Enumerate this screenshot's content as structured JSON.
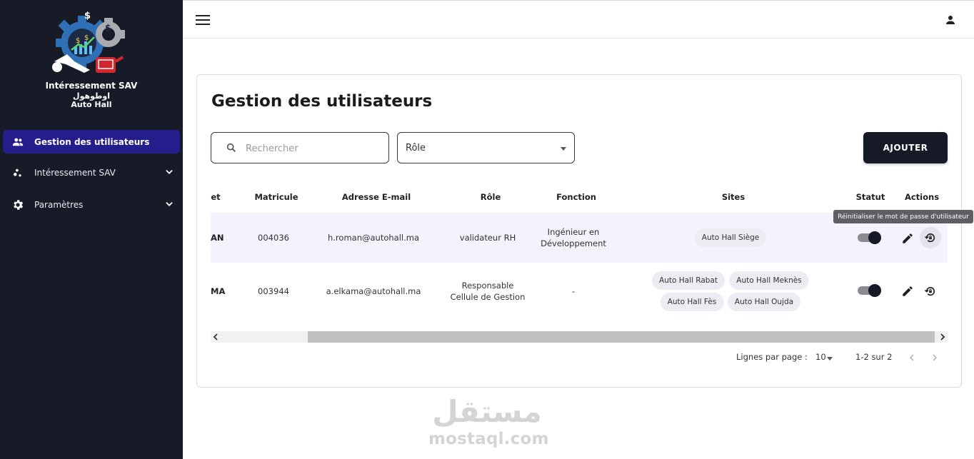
{
  "brand": {
    "line1": "Intéressement SAV",
    "line2": "اوطوهول",
    "line3": "Auto Hall"
  },
  "sidebar": {
    "items": [
      {
        "label": "Gestion des utilisateurs",
        "icon": "people-icon",
        "active": true
      },
      {
        "label": "Intéressement SAV",
        "icon": "bubble-chart-icon",
        "active": false
      },
      {
        "label": "Paramètres",
        "icon": "gear-icon",
        "active": false
      }
    ]
  },
  "main": {
    "title": "Gestion des utilisateurs",
    "search_placeholder": "Rechercher",
    "role_select": "Rôle",
    "add_button": "AJOUTER"
  },
  "table": {
    "columns": [
      "et",
      "Matricule",
      "Adresse E-mail",
      "Rôle",
      "Fonction",
      "Sites",
      "Statut",
      "Actions"
    ],
    "rows": [
      {
        "name": "AN",
        "matricule": "004036",
        "email": "h.roman@autohall.ma",
        "role_l1": "validateur RH",
        "role_l2": "",
        "fonction_l1": "Ingénieur en",
        "fonction_l2": "Développement",
        "sites": [
          "Auto Hall Siège"
        ],
        "status_on": true
      },
      {
        "name": "MA",
        "matricule": "003944",
        "email": "a.elkama@autohall.ma",
        "role_l1": "Responsable",
        "role_l2": "Cellule de Gestion",
        "fonction_l1": "-",
        "fonction_l2": "",
        "sites": [
          "Auto Hall Rabat",
          "Auto Hall Meknès",
          "Auto Hall Fès",
          "Auto Hall Oujda"
        ],
        "status_on": true
      }
    ]
  },
  "pagination": {
    "rows_per_page_label": "Lignes par page :",
    "rows_per_page": "10",
    "range": "1-2 sur 2"
  },
  "tooltip": "Réinitialiser le mot de passe d'utilisateur",
  "watermark": {
    "arabic": "مستقل",
    "latin": "mostaql.com"
  },
  "colors": {
    "sidebar_bg": "#161b27",
    "active_nav": "#241e8c",
    "primary_button": "#151a26",
    "highlight_row": "#f3f2fd"
  }
}
